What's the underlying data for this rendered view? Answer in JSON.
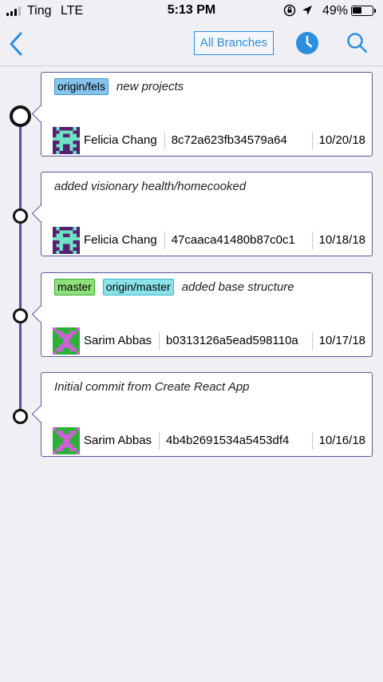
{
  "status_bar": {
    "carrier": "Ting",
    "network": "LTE",
    "time": "5:13 PM",
    "battery": "49%",
    "battery_level": 0.49
  },
  "nav": {
    "back_icon": "chevron-left-icon",
    "branches_label": "All Branches",
    "history_icon": "clock-icon",
    "search_icon": "search-icon",
    "accent_color": "#2e8ede"
  },
  "commits": [
    {
      "tags": [
        {
          "label": "origin/fels",
          "color": "blue"
        }
      ],
      "message": "new projects",
      "author": "Felicia Chang",
      "hash": "8c72a623fb34579a64",
      "date": "10/20/18",
      "avatar": "felicia"
    },
    {
      "tags": [],
      "message": "added visionary health/homecooked",
      "author": "Felicia Chang",
      "hash": "47caaca41480b87c0c1",
      "date": "10/18/18",
      "avatar": "felicia"
    },
    {
      "tags": [
        {
          "label": "master",
          "color": "green"
        },
        {
          "label": "origin/master",
          "color": "cyan"
        }
      ],
      "message": "added base structure",
      "author": "Sarim Abbas",
      "hash": "b0313126a5ead598110a",
      "date": "10/17/18",
      "avatar": "sarim"
    },
    {
      "tags": [],
      "message": "Initial commit from Create React App",
      "author": "Sarim Abbas",
      "hash": "4b4b2691534a5453df4",
      "date": "10/16/18",
      "avatar": "sarim"
    }
  ]
}
